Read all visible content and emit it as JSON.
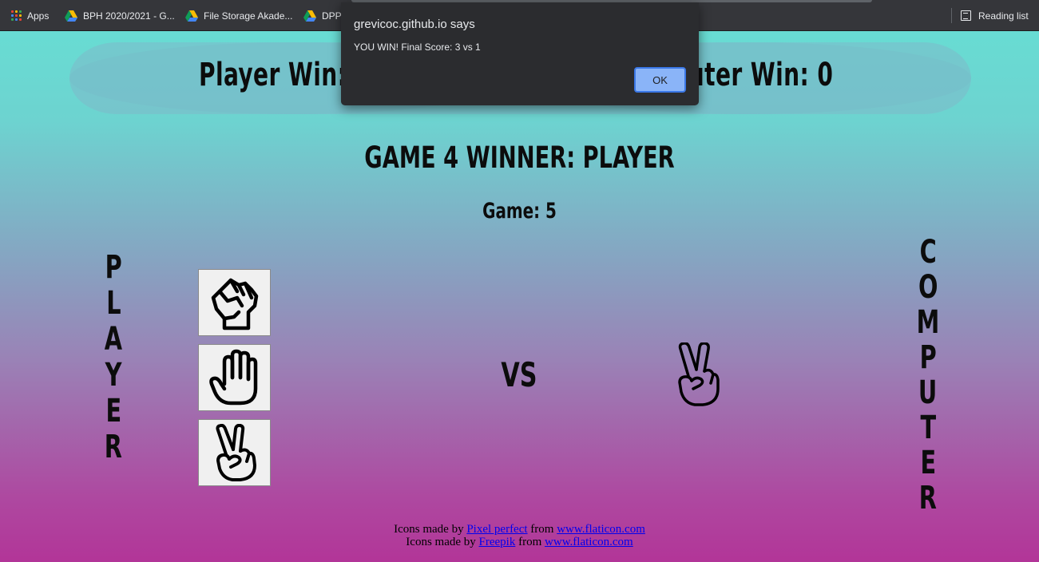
{
  "bookmarks": {
    "items": [
      {
        "label": "Apps",
        "icon": "apps-grid-icon"
      },
      {
        "label": "BPH 2020/2021 - G...",
        "icon": "google-drive-icon"
      },
      {
        "label": "File Storage Akade...",
        "icon": "google-drive-icon"
      },
      {
        "label": "DPP",
        "icon": "google-drive-icon"
      }
    ],
    "reading_list": {
      "label": "Reading list",
      "icon": "reading-list-icon"
    }
  },
  "scoreboard": {
    "player_win": "Player Win: 3",
    "computer_win": "Computer Win: 0"
  },
  "game": {
    "winner_text": "GAME 4 WINNER: PLAYER",
    "game_number": "Game: 5",
    "vs_label": "VS"
  },
  "player_label_letters": [
    "P",
    "L",
    "A",
    "Y",
    "E",
    "R"
  ],
  "computer_label_letters": [
    "C",
    "O",
    "M",
    "P",
    "U",
    "T",
    "E",
    "R"
  ],
  "choices": [
    {
      "name": "rock",
      "icon": "fist-icon"
    },
    {
      "name": "paper",
      "icon": "open-hand-icon"
    },
    {
      "name": "scissors",
      "icon": "peace-hand-icon"
    }
  ],
  "computer_choice": {
    "name": "scissors",
    "icon": "peace-hand-icon"
  },
  "credits": {
    "line1": {
      "prefix": "Icons made by",
      "author": "Pixel perfect",
      "middle": "from",
      "site": "www.flaticon.com"
    },
    "line2": {
      "prefix": "Icons made by",
      "author": "Freepik",
      "middle": "from",
      "site": "www.flaticon.com"
    }
  },
  "dialog": {
    "title": "grevicoc.github.io says",
    "message": "YOU WIN! Final Score: 3 vs 1",
    "ok_label": "OK"
  },
  "colors": {
    "gradient_top": "#68dcd3",
    "gradient_mid": "#85a6c2",
    "gradient_bottom": "#b23598",
    "dialog_bg": "#2b2c2f",
    "ok_button": "#8ab4f8",
    "link": "#0000ee"
  }
}
